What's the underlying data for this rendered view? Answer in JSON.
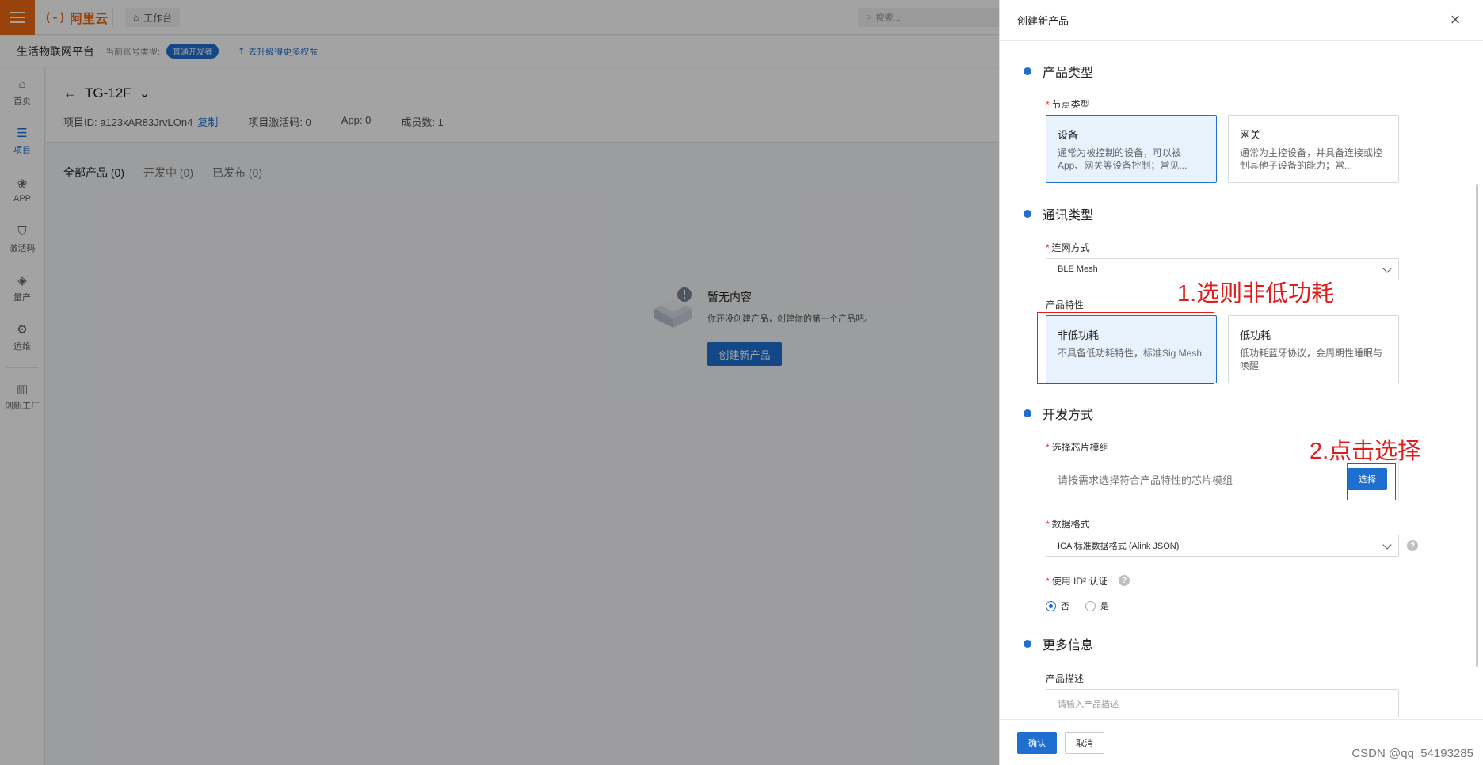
{
  "topbar": {
    "logo_text": "阿里云",
    "logo_mark": "(-)",
    "workbench": "工作台",
    "search_placeholder": "搜索..."
  },
  "subbar": {
    "platform": "生活物联网平台",
    "account_type_label": "当前账号类型:",
    "account_badge": "普通开发者",
    "upgrade_link": "去升级得更多权益"
  },
  "sidenav": {
    "items": [
      {
        "label": "首页",
        "icon": "home-icon"
      },
      {
        "label": "项目",
        "icon": "project-icon",
        "active": true
      },
      {
        "label": "APP",
        "icon": "app-icon"
      },
      {
        "label": "激活码",
        "icon": "shield-icon"
      },
      {
        "label": "量产",
        "icon": "layers-icon"
      },
      {
        "label": "运维",
        "icon": "ops-icon"
      },
      {
        "label": "创新工厂",
        "icon": "factory-icon"
      }
    ]
  },
  "project": {
    "name": "TG-12F",
    "id_label": "项目ID: a123kAR83JrvLOn4",
    "copy_link": "复制",
    "activation_label": "项目激活码: 0",
    "app_label": "App: 0",
    "members_label": "成员数: 1"
  },
  "tabs": [
    "全部产品 (0)",
    "开发中 (0)",
    "已发布 (0)"
  ],
  "empty_state": {
    "title": "暂无内容",
    "desc": "你还没创建产品，创建你的第一个产品吧。",
    "button": "创建新产品"
  },
  "drawer": {
    "title": "创建新产品",
    "sections": {
      "product_type": "产品类型",
      "comm_type": "通讯类型",
      "dev_mode": "开发方式",
      "more_info": "更多信息"
    },
    "node_type_label": "节点类型",
    "node_cards": [
      {
        "title": "设备",
        "desc": "通常为被控制的设备，可以被App、网关等设备控制；常见...",
        "selected": true
      },
      {
        "title": "网关",
        "desc": "通常为主控设备，并具备连接或控制其他子设备的能力；常...",
        "selected": false
      }
    ],
    "network_label": "连网方式",
    "network_value": "BLE Mesh",
    "feature_label": "产品特性",
    "feature_cards": [
      {
        "title": "非低功耗",
        "desc": "不具备低功耗特性，标准Sig Mesh",
        "selected": true
      },
      {
        "title": "低功耗",
        "desc": "低功耗蓝牙协议，会周期性睡眠与唤醒",
        "selected": false
      }
    ],
    "chip_label": "选择芯片模组",
    "chip_placeholder": "请按需求选择符合产品特性的芯片模组",
    "chip_button": "选择",
    "data_format_label": "数据格式",
    "data_format_value": "ICA 标准数据格式 (Alink JSON)",
    "id2_label": "使用 ID² 认证",
    "id2_options": [
      {
        "label": "否",
        "checked": true
      },
      {
        "label": "是",
        "checked": false
      }
    ],
    "desc_label": "产品描述",
    "desc_placeholder": "请输入产品描述",
    "ok_button": "确认",
    "cancel_button": "取消"
  },
  "annotations": {
    "step1": "1.选则非低功耗",
    "step2": "2.点击选择",
    "color": "#e21b1b"
  },
  "watermark": "CSDN @qq_54193285",
  "colors": {
    "brand_orange": "#ec6a0f",
    "primary_blue": "#1f6fd1"
  }
}
